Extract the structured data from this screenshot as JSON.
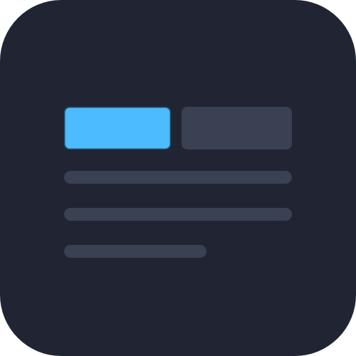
{
  "colors": {
    "background": "#212533",
    "accent": "#4dbbff",
    "muted": "#3a4153"
  },
  "icon": {
    "name": "document-layout-icon"
  }
}
